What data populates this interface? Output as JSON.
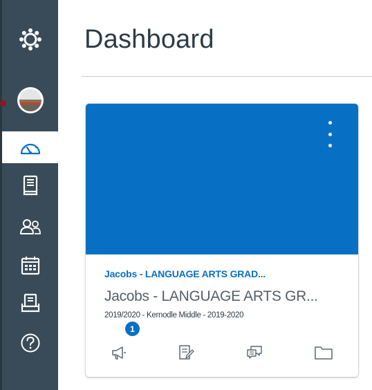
{
  "colors": {
    "nav_bg": "#394B58",
    "accent": "#0770C4",
    "card_hero": "#0770C4",
    "title_text": "#2d3b45"
  },
  "nav": {
    "items": [
      {
        "name": "canvas-logo-icon"
      },
      {
        "name": "account-avatar"
      },
      {
        "name": "dashboard-icon",
        "active": true
      },
      {
        "name": "courses-icon"
      },
      {
        "name": "groups-icon"
      },
      {
        "name": "calendar-icon"
      },
      {
        "name": "inbox-icon"
      },
      {
        "name": "help-icon"
      }
    ]
  },
  "page": {
    "title": "Dashboard"
  },
  "course_card": {
    "link_title": "Jacobs - LANGUAGE ARTS GRAD...",
    "subtitle": "Jacobs - LANGUAGE ARTS GR...",
    "term": "2019/2020 - Kernodle Middle - 2019-2020",
    "announcements_badge": "1",
    "action_icons": [
      "announcements-icon",
      "assignments-icon",
      "discussions-icon",
      "files-icon"
    ]
  }
}
